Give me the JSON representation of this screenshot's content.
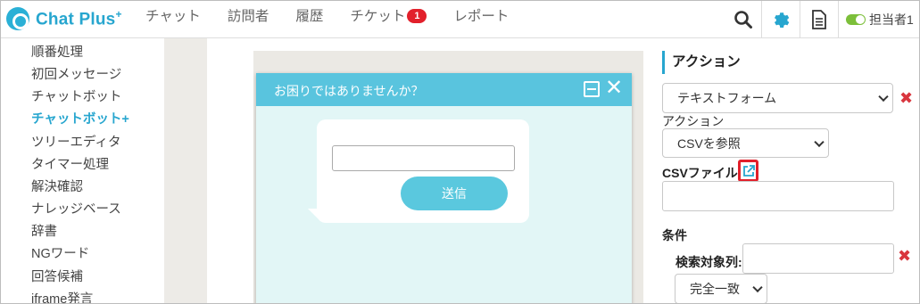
{
  "app": {
    "name": "Chat Plus",
    "name_sup": "+"
  },
  "nav": {
    "items": [
      "チャット",
      "訪問者",
      "履歴",
      "チケット",
      "レポート"
    ],
    "ticket_badge": "1"
  },
  "header": {
    "agent_label": "担当者1"
  },
  "sidebar": {
    "items": [
      "順番処理",
      "初回メッセージ",
      "チャットボット",
      "チャットボット+",
      "ツリーエディタ",
      "タイマー処理",
      "解決確認",
      "ナレッジベース",
      "辞書",
      "NGワード",
      "回答候補",
      "iframe発言"
    ],
    "active_index": 3
  },
  "chat_preview": {
    "title": "お困りではありませんか？",
    "send_label": "送信"
  },
  "panel": {
    "section_title": "アクション",
    "action_select_value": "テキストフォーム",
    "action_label": "アクション",
    "csv_select_value": "CSVを参照",
    "csv_file_label": "CSVファイル",
    "condition_label": "条件",
    "search_column_label": "検索対象列:",
    "match_select_value": "完全一致"
  },
  "colors": {
    "accent": "#27a6cf",
    "badge": "#e2202b",
    "chat_header": "#59c4de",
    "delete": "#d9363e",
    "toggle_on": "#7cbf3a"
  }
}
